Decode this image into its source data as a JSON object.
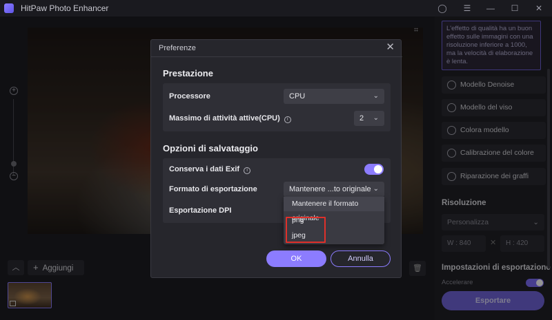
{
  "app": {
    "title": "HitPaw Photo Enhancer"
  },
  "right_panel": {
    "description": "L'effetto di qualità ha un buon effetto sulle immagini con una risoluzione inferiore a 1000, ma la velocità di elaborazione è lenta.",
    "models": [
      {
        "label": "Modello Denoise",
        "icon": "denoise-icon"
      },
      {
        "label": "Modello del viso",
        "icon": "face-icon"
      },
      {
        "label": "Colora modello",
        "icon": "colorize-icon"
      },
      {
        "label": "Calibrazione del colore",
        "icon": "color-calibration-icon"
      },
      {
        "label": "Riparazione dei graffi",
        "icon": "scratch-repair-icon"
      }
    ],
    "resolution_heading": "Risoluzione",
    "resolution_select": "Personalizza",
    "width": "W : 840",
    "height": "H : 420",
    "dim_separator": "✕",
    "export_settings_heading": "Impostazioni di esportazione",
    "accelerate_label": "Accelerare",
    "export_button": "Esportare"
  },
  "bottom": {
    "add_label": "Aggiungi"
  },
  "modal": {
    "title": "Preferenze",
    "close": "✕",
    "performance": {
      "title": "Prestazione",
      "processor_label": "Processore",
      "processor_value": "CPU",
      "max_tasks_label": "Massimo di attività attive(CPU)",
      "max_tasks_value": "2"
    },
    "save_options": {
      "title": "Opzioni di salvataggio",
      "exif_label": "Conserva i dati Exif",
      "exif_enabled": true,
      "format_label": "Formato di esportazione",
      "format_value": "Mantenere ...to originale",
      "dpi_label": "Esportazione DPI",
      "format_options": [
        "Mantenere il formato originale",
        "png",
        "jpeg"
      ]
    },
    "ok": "OK",
    "cancel": "Annulla"
  },
  "colors": {
    "accent": "#8c7cff",
    "highlight_box": "#e0302a"
  }
}
